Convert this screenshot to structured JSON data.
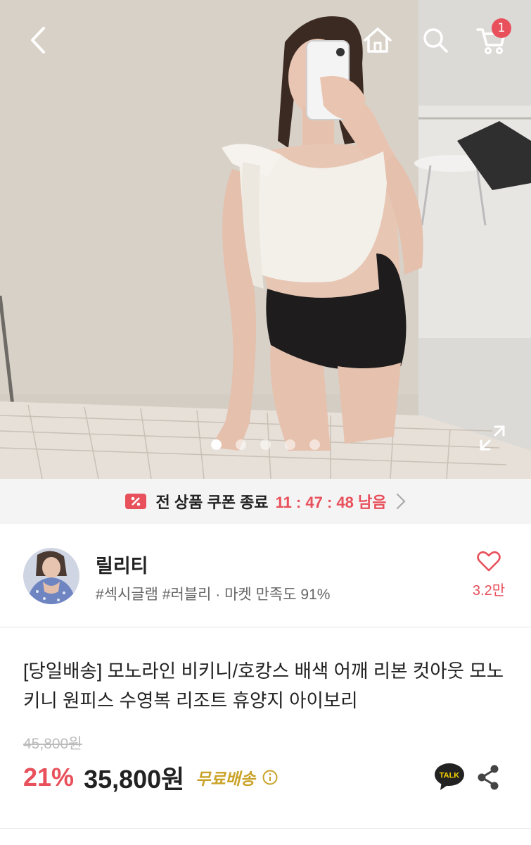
{
  "header": {
    "cart_count": "1"
  },
  "gallery": {
    "slide_count": 5,
    "active_index": 0
  },
  "coupon": {
    "label": "전 상품 쿠폰 종료",
    "timer": "11 : 47 : 48 남음"
  },
  "seller": {
    "name": "릴리티",
    "tags": "#섹시글램 #러블리 · 마켓 만족도 91%",
    "likes": "3.2만"
  },
  "product": {
    "title": "[당일배송] 모노라인 비키니/호캉스 배색 어깨 리본 컷아웃 모노키니 원피스 수영복 리조트 휴양지 아이보리",
    "original_price": "45,800원",
    "discount": "21%",
    "price": "35,800원",
    "shipping": "무료배송"
  },
  "icons": {
    "back": "chevron-left-icon",
    "home": "home-icon",
    "search": "search-icon",
    "cart": "cart-icon",
    "expand": "expand-icon",
    "coupon": "coupon-icon",
    "heart": "heart-icon",
    "info": "info-icon",
    "talk": "kakao-talk-icon",
    "share": "share-icon"
  },
  "colors": {
    "accent": "#e8505b",
    "shipping": "#c9a227",
    "coupon_bg": "#f4f4f5"
  }
}
